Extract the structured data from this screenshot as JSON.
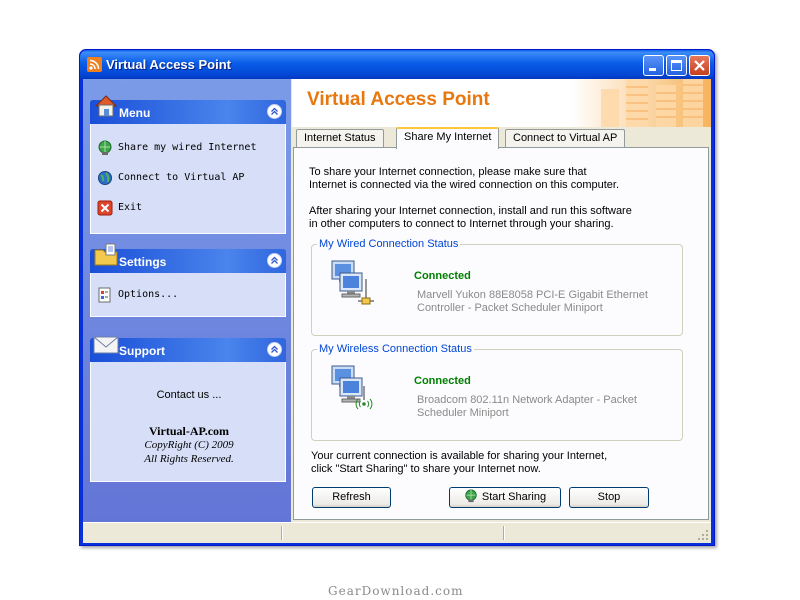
{
  "window": {
    "title": "Virtual Access Point",
    "icon": "rss-icon"
  },
  "sidebar": {
    "menu": {
      "title": "Menu",
      "items": [
        {
          "label": "Share my wired Internet",
          "icon": "share-globe-icon"
        },
        {
          "label": "Connect to Virtual AP",
          "icon": "connect-globe-icon"
        },
        {
          "label": "Exit",
          "icon": "exit-icon"
        }
      ]
    },
    "settings": {
      "title": "Settings",
      "items": [
        {
          "label": "Options...",
          "icon": "options-icon"
        }
      ]
    },
    "support": {
      "title": "Support",
      "contact": "Contact us ...",
      "site": "Virtual-AP.com",
      "copyright": "CopyRight (C) 2009",
      "rights": "All Rights Reserved."
    }
  },
  "banner": {
    "title": "Virtual Access Point"
  },
  "tabs": [
    {
      "label": "Internet Status",
      "active": false
    },
    {
      "label": "Share My Internet",
      "active": true
    },
    {
      "label": "Connect to Virtual AP",
      "active": false
    }
  ],
  "share_page": {
    "intro_line1": "To share your Internet connection, please make sure that",
    "intro_line2": "Internet is connected via the wired connection on this computer.",
    "after_line1": "After sharing your Internet connection, install and run this software",
    "after_line2": "in other computers to connect to Internet through your sharing.",
    "wired": {
      "label": "My Wired Connection Status",
      "status": "Connected",
      "adapter": "Marvell Yukon 88E8058 PCI-E Gigabit Ethernet Controller - Packet Scheduler Miniport"
    },
    "wireless": {
      "label": "My Wireless Connection Status",
      "status": "Connected",
      "adapter": "Broadcom 802.11n Network Adapter - Packet Scheduler Miniport"
    },
    "footer_line1": "Your current connection is available for sharing your Internet,",
    "footer_line2": "click \"Start Sharing\" to share your Internet now.",
    "buttons": {
      "refresh": "Refresh",
      "start": "Start Sharing",
      "stop": "Stop"
    }
  },
  "colors": {
    "accent_orange": "#e8770e",
    "connected_green": "#008000",
    "groupbox_label_blue": "#0046d5",
    "xp_title_blue": "#0a5de8"
  },
  "watermark": "GearDownload.com"
}
